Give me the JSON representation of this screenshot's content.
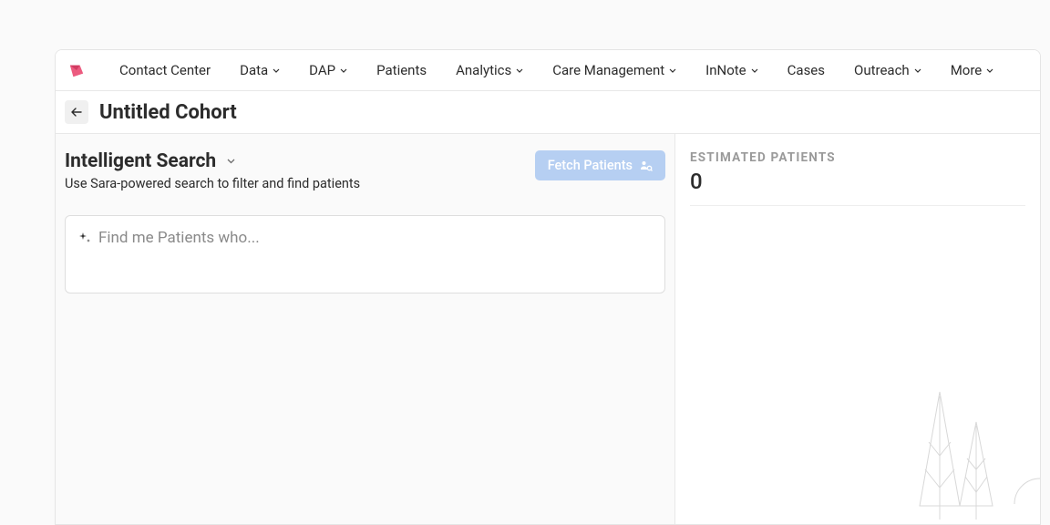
{
  "nav": {
    "items": [
      {
        "label": "Contact Center",
        "hasDropdown": false
      },
      {
        "label": "Data",
        "hasDropdown": true
      },
      {
        "label": "DAP",
        "hasDropdown": true
      },
      {
        "label": "Patients",
        "hasDropdown": false
      },
      {
        "label": "Analytics",
        "hasDropdown": true
      },
      {
        "label": "Care Management",
        "hasDropdown": true
      },
      {
        "label": "InNote",
        "hasDropdown": true
      },
      {
        "label": "Cases",
        "hasDropdown": false
      },
      {
        "label": "Outreach",
        "hasDropdown": true
      },
      {
        "label": "More",
        "hasDropdown": true
      }
    ]
  },
  "page": {
    "title": "Untitled Cohort"
  },
  "search": {
    "title": "Intelligent Search",
    "subtitle": "Use Sara-powered search to filter and find patients",
    "placeholder": "Find me Patients who...",
    "fetchLabel": "Fetch Patients"
  },
  "sidebar": {
    "estLabel": "ESTIMATED PATIENTS",
    "estCount": "0"
  }
}
